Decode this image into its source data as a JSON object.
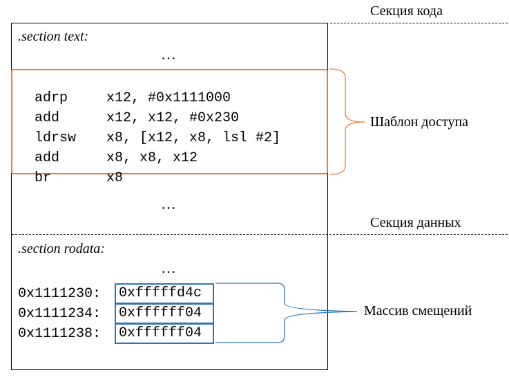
{
  "labels": {
    "code_section": "Секция кода",
    "data_section": "Секция данных",
    "access_pattern": "Шаблон доступа",
    "offset_array": "Массив смещений"
  },
  "text_section": {
    "header": ".section text:",
    "ellipsis_top": "…",
    "ellipsis_bottom": "…",
    "instructions": [
      {
        "op": "adrp",
        "args": "x12, #0x1111000"
      },
      {
        "op": "add",
        "args": "x12, x12, #0x230"
      },
      {
        "op": "ldrsw",
        "args": "x8, [x12, x8, lsl #2]"
      },
      {
        "op": "add",
        "args": "x8, x8, x12"
      },
      {
        "op": "br",
        "args": "x8"
      }
    ]
  },
  "rodata_section": {
    "header": ".section rodata:",
    "ellipsis": "…",
    "entries": [
      {
        "address": "0x1111230:",
        "value": "0xfffffd4c"
      },
      {
        "address": "0x1111234:",
        "value": "0xffffff04"
      },
      {
        "address": "0x1111238:",
        "value": "0xffffff04"
      }
    ]
  },
  "colors": {
    "access_pattern_border": "#ED7D31",
    "offset_array_border": "#2E75B6"
  }
}
